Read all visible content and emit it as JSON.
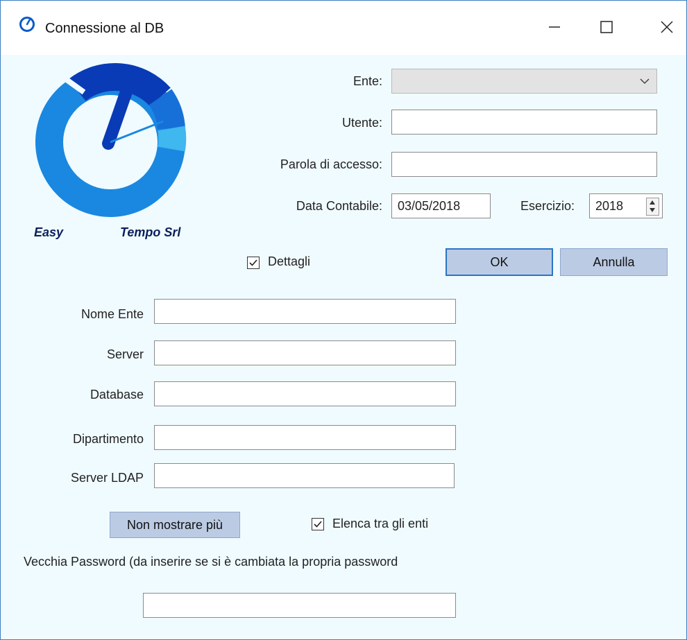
{
  "window": {
    "title": "Connessione al DB",
    "buttons": {
      "minimize": "minimize-icon",
      "maximize": "maximize-icon",
      "close": "close-icon"
    }
  },
  "logo": {
    "left_text": "Easy",
    "right_text": "Tempo Srl",
    "colors": {
      "dark": "#0a3bb6",
      "mid": "#1a88e0",
      "light": "#3fb7ef"
    }
  },
  "form": {
    "ente": {
      "label": "Ente:",
      "value": ""
    },
    "utente": {
      "label": "Utente:",
      "value": ""
    },
    "password": {
      "label": "Parola di accesso:",
      "value": ""
    },
    "data_contabile": {
      "label": "Data Contabile:",
      "value": "03/05/2018"
    },
    "esercizio": {
      "label": "Esercizio:",
      "value": "2018"
    },
    "dettagli": {
      "label": "Dettagli",
      "checked": true
    },
    "ok": "OK",
    "annulla": "Annulla"
  },
  "details": {
    "nome_ente": {
      "label": "Nome Ente",
      "value": ""
    },
    "server": {
      "label": "Server",
      "value": ""
    },
    "database": {
      "label": "Database",
      "value": ""
    },
    "dipartimento": {
      "label": "Dipartimento",
      "value": ""
    },
    "server_ldap": {
      "label": "Server LDAP",
      "value": ""
    },
    "non_mostrare": "Non mostrare più",
    "elenca": {
      "label": "Elenca tra gli enti",
      "checked": true
    },
    "vecchia_password": {
      "label": "Vecchia Password (da inserire se si è cambiata la propria password",
      "value": ""
    }
  },
  "colors": {
    "window_bg": "#f0fbff",
    "button_bg": "#bccbe4",
    "accent_border": "#3c7fc0"
  }
}
